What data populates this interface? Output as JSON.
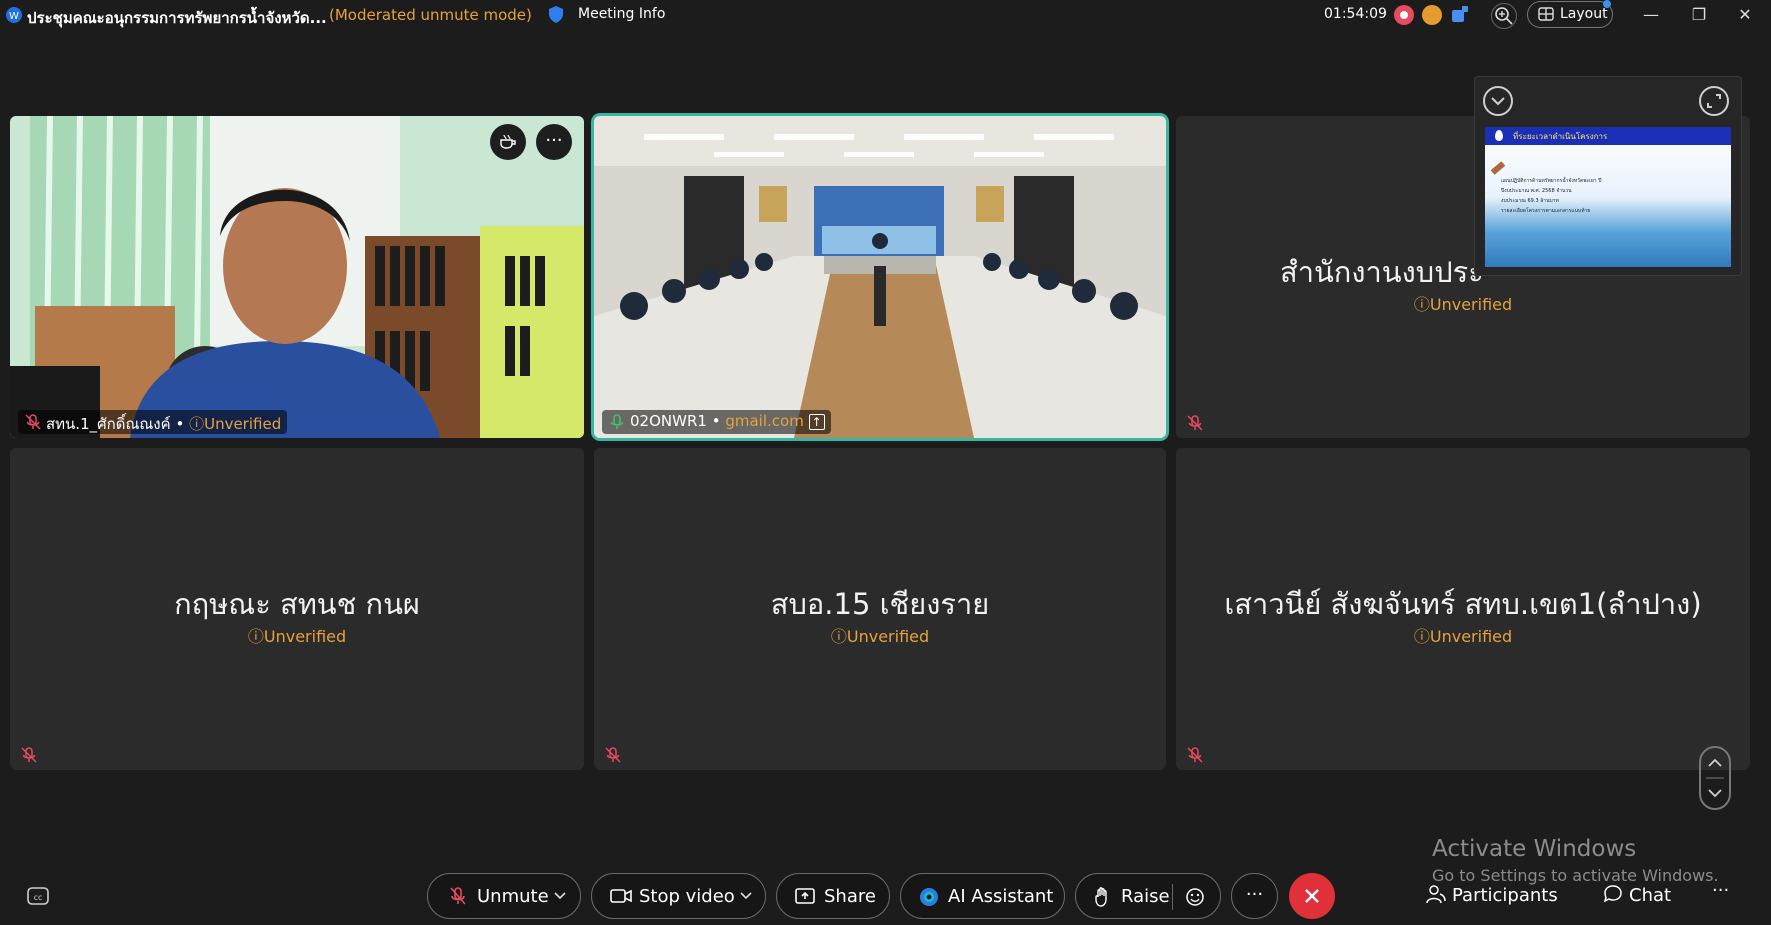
{
  "titlebar": {
    "meeting_title": "ประชุมคณะอนุกรรมการทรัพยากรน้ำจังหวัด...",
    "mode": "(Moderated unmute mode)",
    "meeting_info": "Meeting Info",
    "clock": "01:54:09",
    "layout_label": "Layout"
  },
  "tiles": [
    {
      "name_tag": "สทน.1_ศักดิ์ณณงค์",
      "separator": "•",
      "status": "Unverified",
      "has_video": true
    },
    {
      "name_tag": "02ONWR1",
      "separator": "•",
      "email_domain": "gmail.com",
      "has_video": true,
      "active": true
    },
    {
      "name": "สำนักงานงบประ",
      "status": "Unverified"
    },
    {
      "name": "กฤษณะ สทนช กนผ",
      "status": "Unverified"
    },
    {
      "name": "สบอ.15 เชียงราย",
      "status": "Unverified"
    },
    {
      "name": "เสาวนีย์ สังฆจันทร์ สทบ.เขต1(ลำปาง)",
      "status": "Unverified"
    }
  ],
  "share_preview": {
    "slide_title": "ที่ระยะเวลาดำเนินโครงการ",
    "slide_lines": [
      "แผนปฏิบัติการด้านทรัพยากรน้ำจังหวัดพะเยา ปี",
      "ปีงบประมาณ พ.ศ. 2568 จำนวน",
      "งบประมาณ 69.3 ล้านบาท",
      "รายละเอียดโครงการตามเอกสารแนบท้าย"
    ]
  },
  "toolbar": {
    "unmute": "Unmute",
    "stop_video": "Stop video",
    "share": "Share",
    "ai_assistant": "AI Assistant",
    "raise": "Raise",
    "more": "···",
    "participants": "Participants",
    "chat": "Chat",
    "overflow": "···"
  },
  "watermark": {
    "line1": "Activate Windows",
    "line2": "Go to Settings to activate Windows."
  },
  "colors": {
    "background": "#1c1c1c",
    "tile": "#2b2b2b",
    "unverified": "#e6a23c",
    "active_border": "#35b7a3",
    "end_call": "#e0313a"
  }
}
